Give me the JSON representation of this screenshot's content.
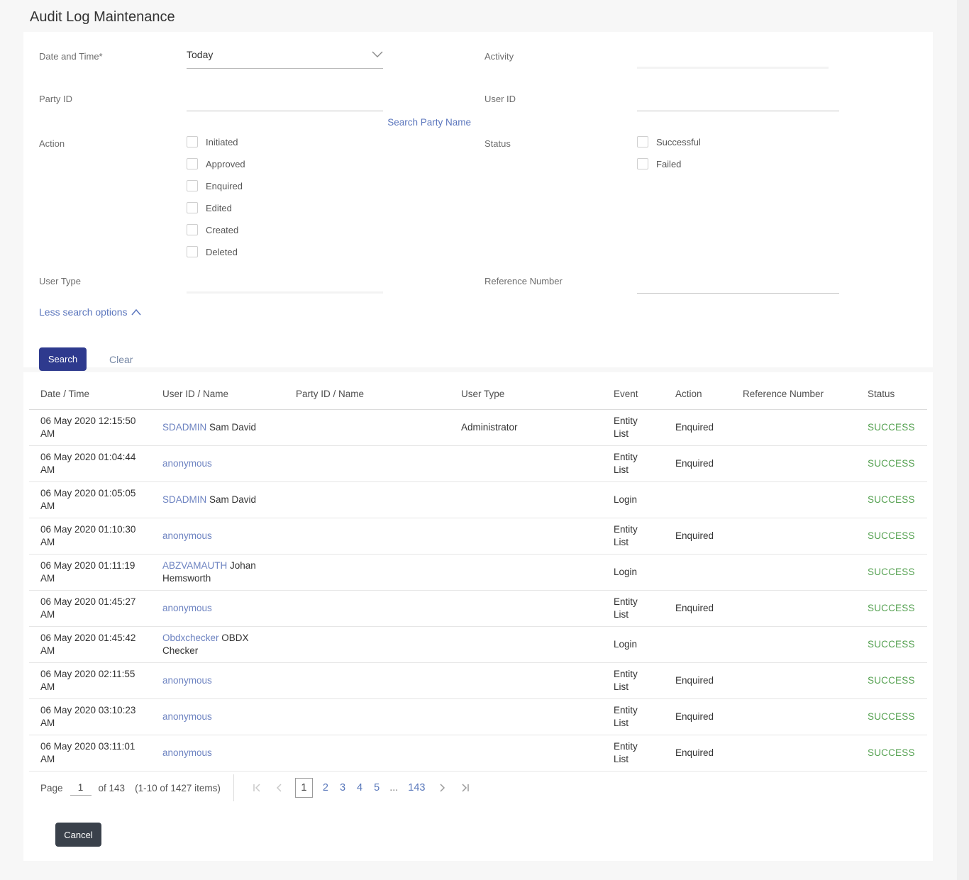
{
  "page": {
    "title": "Audit Log Maintenance"
  },
  "filters": {
    "date_time": {
      "label": "Date and Time*",
      "value": "Today"
    },
    "activity": {
      "label": "Activity"
    },
    "party_id": {
      "label": "Party ID"
    },
    "user_id": {
      "label": "User ID"
    },
    "search_party_link": "Search Party Name",
    "action": {
      "label": "Action",
      "options": [
        "Initiated",
        "Approved",
        "Enquired",
        "Edited",
        "Created",
        "Deleted"
      ]
    },
    "status": {
      "label": "Status",
      "options": [
        "Successful",
        "Failed"
      ]
    },
    "user_type": {
      "label": "User Type"
    },
    "reference_number": {
      "label": "Reference Number"
    },
    "less_options_link": "Less search options",
    "search_button": "Search",
    "clear_button": "Clear"
  },
  "table": {
    "headers": [
      "Date / Time",
      "User ID / Name",
      "Party ID / Name",
      "User Type",
      "Event",
      "Action",
      "Reference Number",
      "Status"
    ],
    "rows": [
      {
        "datetime": "06 May 2020 12:15:50 AM",
        "user_id": "SDADMIN",
        "user_name": "Sam David",
        "party": "",
        "user_type": "Administrator",
        "event": "Entity List",
        "action": "Enquired",
        "ref": "",
        "status": "SUCCESS"
      },
      {
        "datetime": "06 May 2020 01:04:44 AM",
        "user_id": "anonymous",
        "user_name": "",
        "party": "",
        "user_type": "",
        "event": "Entity List",
        "action": "Enquired",
        "ref": "",
        "status": "SUCCESS"
      },
      {
        "datetime": "06 May 2020 01:05:05 AM",
        "user_id": "SDADMIN",
        "user_name": "Sam David",
        "party": "",
        "user_type": "",
        "event": "Login",
        "action": "",
        "ref": "",
        "status": "SUCCESS"
      },
      {
        "datetime": "06 May 2020 01:10:30 AM",
        "user_id": "anonymous",
        "user_name": "",
        "party": "",
        "user_type": "",
        "event": "Entity List",
        "action": "Enquired",
        "ref": "",
        "status": "SUCCESS"
      },
      {
        "datetime": "06 May 2020 01:11:19 AM",
        "user_id": "ABZVAMAUTH",
        "user_name": "Johan Hemsworth",
        "party": "",
        "user_type": "",
        "event": "Login",
        "action": "",
        "ref": "",
        "status": "SUCCESS"
      },
      {
        "datetime": "06 May 2020 01:45:27 AM",
        "user_id": "anonymous",
        "user_name": "",
        "party": "",
        "user_type": "",
        "event": "Entity List",
        "action": "Enquired",
        "ref": "",
        "status": "SUCCESS"
      },
      {
        "datetime": "06 May 2020 01:45:42 AM",
        "user_id": "Obdxchecker",
        "user_name": "OBDX Checker",
        "party": "",
        "user_type": "",
        "event": "Login",
        "action": "",
        "ref": "",
        "status": "SUCCESS"
      },
      {
        "datetime": "06 May 2020 02:11:55 AM",
        "user_id": "anonymous",
        "user_name": "",
        "party": "",
        "user_type": "",
        "event": "Entity List",
        "action": "Enquired",
        "ref": "",
        "status": "SUCCESS"
      },
      {
        "datetime": "06 May 2020 03:10:23 AM",
        "user_id": "anonymous",
        "user_name": "",
        "party": "",
        "user_type": "",
        "event": "Entity List",
        "action": "Enquired",
        "ref": "",
        "status": "SUCCESS"
      },
      {
        "datetime": "06 May 2020 03:11:01 AM",
        "user_id": "anonymous",
        "user_name": "",
        "party": "",
        "user_type": "",
        "event": "Entity List",
        "action": "Enquired",
        "ref": "",
        "status": "SUCCESS"
      }
    ]
  },
  "pagination": {
    "page_label": "Page",
    "page_value": "1",
    "of_text": "of 143",
    "items_text": "(1-10 of 1427 items)",
    "pages": [
      "1",
      "2",
      "3",
      "4",
      "5",
      "...",
      "143"
    ],
    "current_page": "1"
  },
  "footer": {
    "cancel_button": "Cancel"
  },
  "colors": {
    "primary_button": "#2e3a8e",
    "cancel_button": "#3a414b",
    "link_blue": "#5b76bd",
    "user_link_blue": "#6d83c1",
    "success_green": "#55a151"
  }
}
